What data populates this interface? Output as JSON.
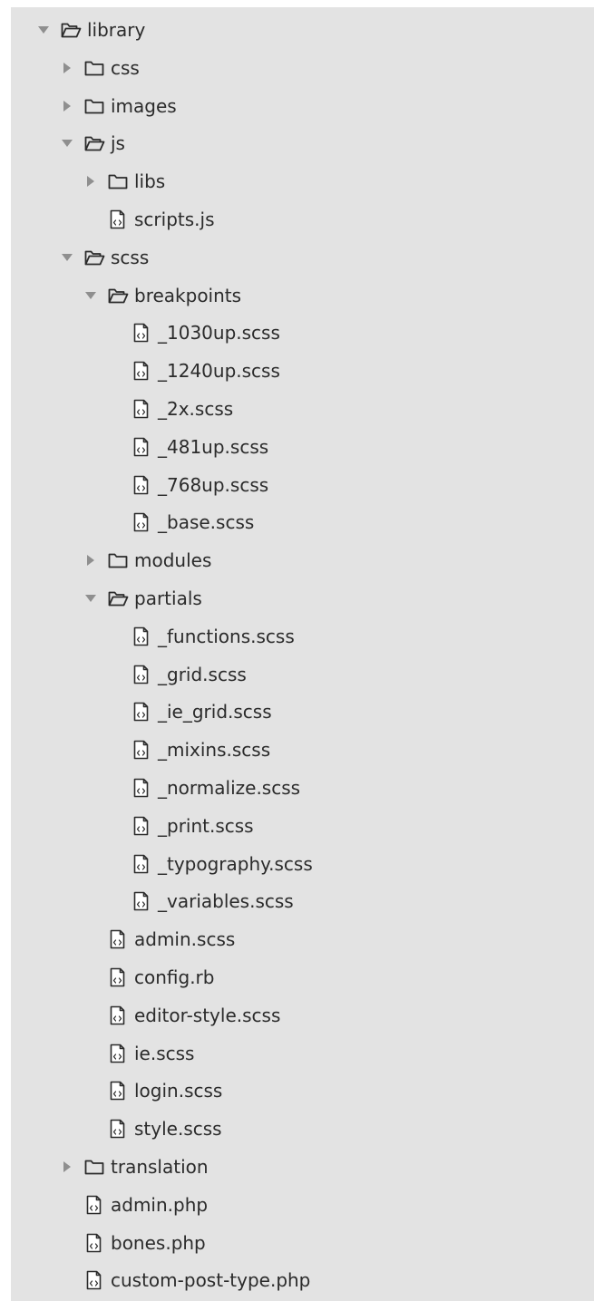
{
  "tree": [
    {
      "name": "library",
      "type": "folder",
      "state": "expanded",
      "depth": 0
    },
    {
      "name": "css",
      "type": "folder",
      "state": "collapsed",
      "depth": 1
    },
    {
      "name": "images",
      "type": "folder",
      "state": "collapsed",
      "depth": 1
    },
    {
      "name": "js",
      "type": "folder",
      "state": "expanded",
      "depth": 1
    },
    {
      "name": "libs",
      "type": "folder",
      "state": "collapsed",
      "depth": 2
    },
    {
      "name": "scripts.js",
      "type": "file",
      "depth": 2
    },
    {
      "name": "scss",
      "type": "folder",
      "state": "expanded",
      "depth": 1
    },
    {
      "name": "breakpoints",
      "type": "folder",
      "state": "expanded",
      "depth": 2
    },
    {
      "name": "_1030up.scss",
      "type": "file",
      "depth": 3
    },
    {
      "name": "_1240up.scss",
      "type": "file",
      "depth": 3
    },
    {
      "name": "_2x.scss",
      "type": "file",
      "depth": 3
    },
    {
      "name": "_481up.scss",
      "type": "file",
      "depth": 3
    },
    {
      "name": "_768up.scss",
      "type": "file",
      "depth": 3
    },
    {
      "name": "_base.scss",
      "type": "file",
      "depth": 3
    },
    {
      "name": "modules",
      "type": "folder",
      "state": "collapsed",
      "depth": 2
    },
    {
      "name": "partials",
      "type": "folder",
      "state": "expanded",
      "depth": 2
    },
    {
      "name": "_functions.scss",
      "type": "file",
      "depth": 3
    },
    {
      "name": "_grid.scss",
      "type": "file",
      "depth": 3
    },
    {
      "name": "_ie_grid.scss",
      "type": "file",
      "depth": 3
    },
    {
      "name": "_mixins.scss",
      "type": "file",
      "depth": 3
    },
    {
      "name": "_normalize.scss",
      "type": "file",
      "depth": 3
    },
    {
      "name": "_print.scss",
      "type": "file",
      "depth": 3
    },
    {
      "name": "_typography.scss",
      "type": "file",
      "depth": 3
    },
    {
      "name": "_variables.scss",
      "type": "file",
      "depth": 3
    },
    {
      "name": "admin.scss",
      "type": "file",
      "depth": 2
    },
    {
      "name": "config.rb",
      "type": "file",
      "depth": 2
    },
    {
      "name": "editor-style.scss",
      "type": "file",
      "depth": 2
    },
    {
      "name": "ie.scss",
      "type": "file",
      "depth": 2
    },
    {
      "name": "login.scss",
      "type": "file",
      "depth": 2
    },
    {
      "name": "style.scss",
      "type": "file",
      "depth": 2
    },
    {
      "name": "translation",
      "type": "folder",
      "state": "collapsed",
      "depth": 1
    },
    {
      "name": "admin.php",
      "type": "file",
      "depth": 1
    },
    {
      "name": "bones.php",
      "type": "file",
      "depth": 1
    },
    {
      "name": "custom-post-type.php",
      "type": "file",
      "depth": 1
    }
  ],
  "icons": {
    "folder_closed": "folder-icon",
    "folder_open": "folder-open-icon",
    "file": "code-file-icon",
    "expand": "triangle-right-icon",
    "collapse": "triangle-down-icon"
  },
  "colors": {
    "panel_background": "#e3e3e3",
    "text": "#2b2b2b",
    "twisty": "#8f8f8f",
    "icon_stroke": "#2b2b2b"
  }
}
